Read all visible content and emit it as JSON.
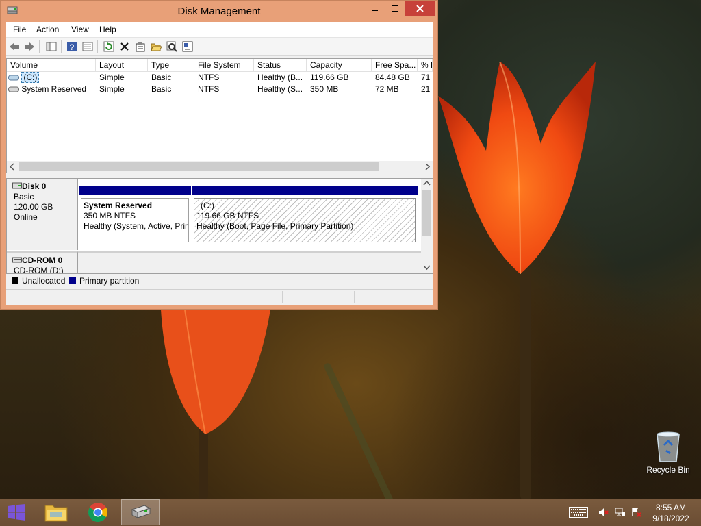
{
  "window": {
    "title": "Disk Management",
    "menu": [
      "File",
      "Action",
      "View",
      "Help"
    ]
  },
  "volume_list": {
    "columns": [
      "Volume",
      "Layout",
      "Type",
      "File System",
      "Status",
      "Capacity",
      "Free Spa...",
      "% F"
    ],
    "rows": [
      {
        "volume": "(C:)",
        "layout": "Simple",
        "type": "Basic",
        "fs": "NTFS",
        "status": "Healthy (B...",
        "capacity": "119.66 GB",
        "free": "84.48 GB",
        "pct": "71"
      },
      {
        "volume": "System Reserved",
        "layout": "Simple",
        "type": "Basic",
        "fs": "NTFS",
        "status": "Healthy (S...",
        "capacity": "350 MB",
        "free": "72 MB",
        "pct": "21"
      }
    ]
  },
  "disks": [
    {
      "name": "Disk 0",
      "kind": "Basic",
      "size": "120.00 GB",
      "state": "Online",
      "partitions": [
        {
          "name": "System Reserved",
          "size": "350 MB NTFS",
          "status": "Healthy (System, Active, Prir"
        },
        {
          "name": "(C:)",
          "size": "119.66 GB NTFS",
          "status": "Healthy (Boot, Page File, Primary Partition)"
        }
      ]
    },
    {
      "name": "CD-ROM 0",
      "kind": "CD-ROM (D:)"
    }
  ],
  "legend": [
    {
      "label": "Unallocated",
      "color": "#000000"
    },
    {
      "label": "Primary partition",
      "color": "#00008b"
    }
  ],
  "desktop": {
    "recycle_bin": "Recycle Bin"
  },
  "taskbar": {
    "time": "8:55 AM",
    "date": "9/18/2022"
  },
  "colors": {
    "accent": "#e8a078",
    "close": "#c7413a",
    "partition_bar": "#00008b"
  }
}
